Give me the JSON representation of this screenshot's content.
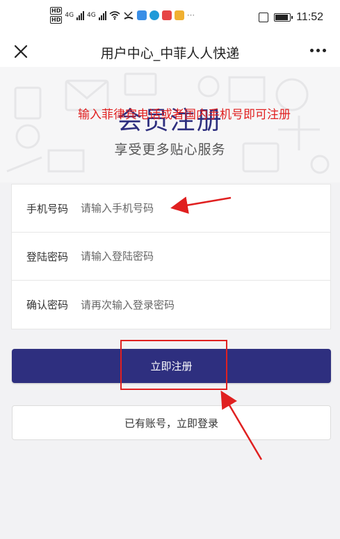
{
  "status_bar": {
    "hd_badges": [
      "HD",
      "HD"
    ],
    "network_labels": [
      "4G",
      "4G"
    ],
    "time": "11:52",
    "icons": [
      "hd-icon",
      "signal-icon",
      "wifi-icon",
      "missed-call-icon",
      "app-notification-icons",
      "vibrate-icon",
      "battery-icon"
    ]
  },
  "nav": {
    "title": "用户中心_中菲人人快递",
    "close_icon": "close-icon",
    "more_icon": "more-icon"
  },
  "hero": {
    "title": "会员注册",
    "subtitle": "享受更多贴心服务"
  },
  "annotation": {
    "note": "输入菲律宾电话或者国内手机号即可注册",
    "color": "#e02020"
  },
  "form": {
    "phone": {
      "label": "手机号码",
      "placeholder": "请输入手机号码"
    },
    "password": {
      "label": "登陆密码",
      "placeholder": "请输入登陆密码"
    },
    "confirm": {
      "label": "确认密码",
      "placeholder": "请再次输入登录密码"
    }
  },
  "buttons": {
    "register": "立即注册",
    "login": "已有账号，立即登录"
  },
  "colors": {
    "brand": "#2e2f7f",
    "annotation": "#e02020"
  }
}
